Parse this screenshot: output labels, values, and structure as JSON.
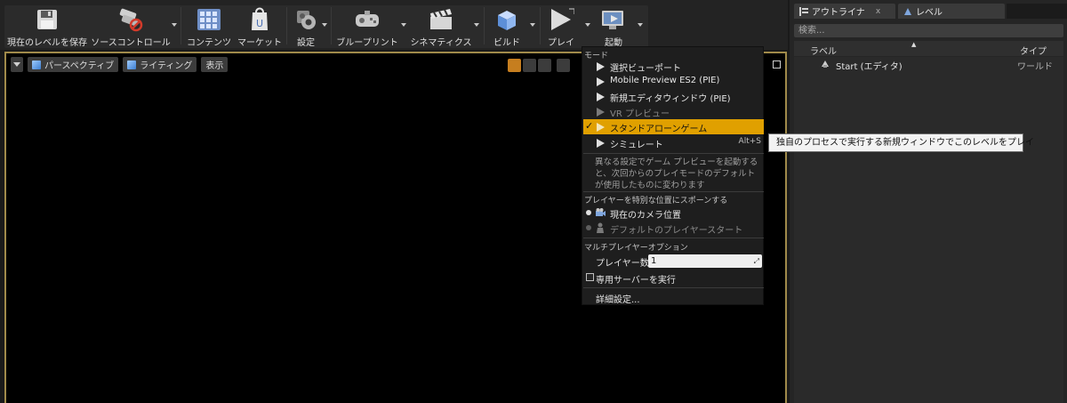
{
  "toolbar": {
    "buttons": [
      {
        "label": "現在のレベルを保存",
        "icon": "save-icon"
      },
      {
        "label": "ソースコントロール",
        "icon": "source-control-icon"
      },
      {
        "label": "コンテンツ",
        "icon": "content-icon"
      },
      {
        "label": "マーケット",
        "icon": "marketplace-icon"
      },
      {
        "label": "設定",
        "icon": "settings-icon"
      },
      {
        "label": "ブループリント",
        "icon": "blueprint-icon"
      },
      {
        "label": "シネマティクス",
        "icon": "cinematics-icon"
      },
      {
        "label": "ビルド",
        "icon": "build-icon"
      },
      {
        "label": "プレイ",
        "icon": "play-icon"
      },
      {
        "label": "起動",
        "icon": "launch-icon"
      }
    ]
  },
  "viewport": {
    "perspective": "パースペクティブ",
    "lighting": "ライティング",
    "show": "表示"
  },
  "panel": {
    "tabs": [
      {
        "label": "アウトライナ"
      },
      {
        "label": "レベル"
      }
    ],
    "close": "x",
    "search_placeholder": "検索...",
    "col_label": "ラベル",
    "col_type": "タイプ",
    "rows": [
      {
        "name": "Start (エディタ)",
        "type": "ワールド"
      }
    ]
  },
  "menu": {
    "section_mode": "モード",
    "items": [
      {
        "label": "選択ビューポート"
      },
      {
        "label": "Mobile Preview ES2 (PIE)"
      },
      {
        "label": "新規エディタウィンドウ (PIE)"
      },
      {
        "label": "VR プレビュー"
      },
      {
        "label": "スタンドアローンゲーム"
      },
      {
        "label": "シミュレート",
        "shortcut": "Alt+S"
      }
    ],
    "check_mark": "✓",
    "description": "異なる設定でゲーム プレビューを起動すると、次回からのプレイモードのデフォルトが使用したものに変わります",
    "section_spawn": "プレイヤーを特別な位置にスポーンする",
    "spawn_current": "現在のカメラ位置",
    "spawn_default": "デフォルトのプレイヤースタート",
    "section_multi": "マルチプレイヤーオプション",
    "player_count_label": "プレイヤー数",
    "player_count_value": "1",
    "dedicated_server": "専用サーバーを実行",
    "advanced": "詳細設定..."
  },
  "tooltip": {
    "text": "独自のプロセスで実行する新規ウィンドウでこのレベルをプレイ"
  },
  "colors": {
    "accent": "#e0a000",
    "viewport_border": "#a08a4a"
  }
}
